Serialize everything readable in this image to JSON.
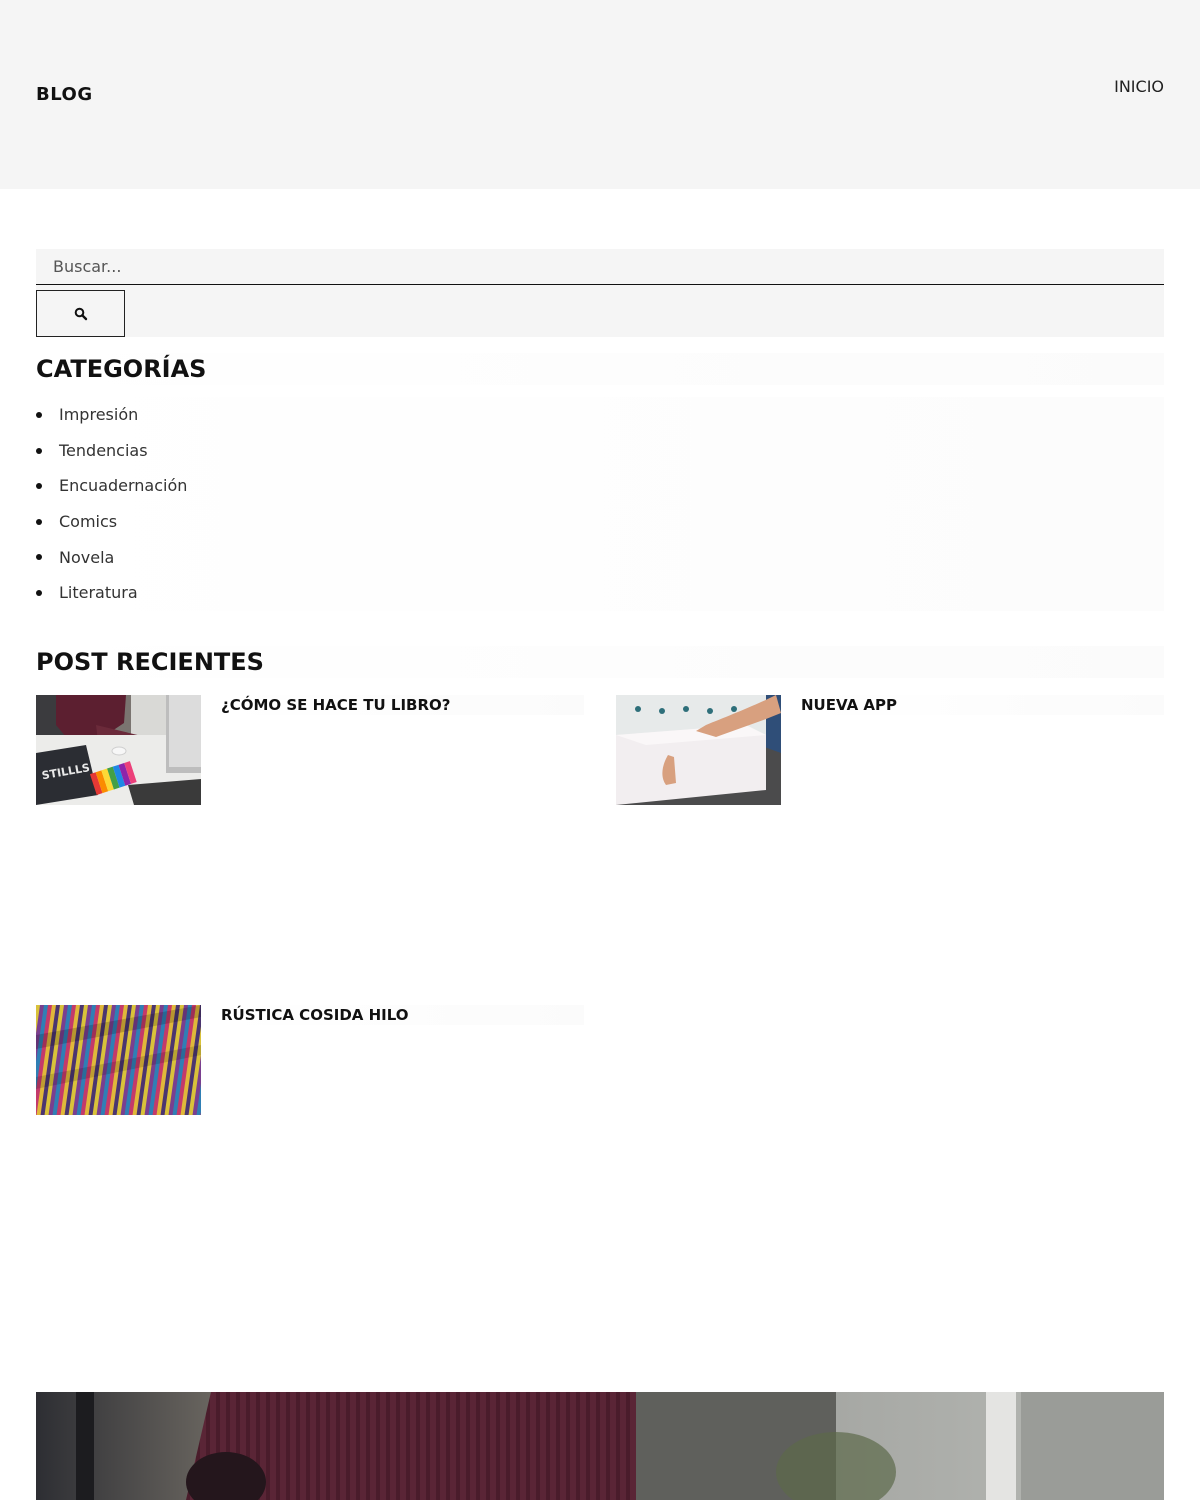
{
  "header": {
    "brand": "BLOG",
    "nav": [
      {
        "label": "INICIO"
      }
    ]
  },
  "search": {
    "placeholder": "Buscar...",
    "button_icon": "search-icon"
  },
  "categories": {
    "title": "CATEGORÍAS",
    "items": [
      {
        "label": "Impresión"
      },
      {
        "label": "Tendencias"
      },
      {
        "label": "Encuadernación"
      },
      {
        "label": "Comics"
      },
      {
        "label": "Novela"
      },
      {
        "label": "Literatura"
      }
    ]
  },
  "recent_posts": {
    "title": "POST RECIENTES",
    "items": [
      {
        "title": "¿CÓMO SE HACE TU LIBRO?",
        "thumbnail": "designer-at-computer-thumbnail"
      },
      {
        "title": "NUEVA APP",
        "thumbnail": "paper-stack-cutter-thumbnail"
      },
      {
        "title": "RÚSTICA COSIDA HILO",
        "thumbnail": "colorful-thread-spines-thumbnail"
      }
    ]
  },
  "hero": {
    "image": "designer-sweater-hero-image"
  }
}
